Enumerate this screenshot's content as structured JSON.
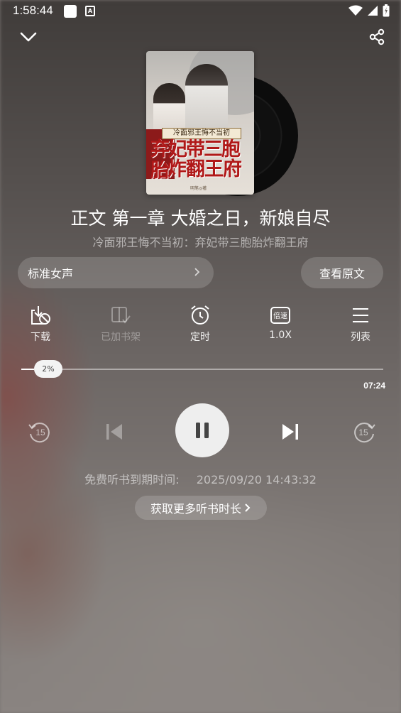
{
  "status_bar": {
    "time": "1:58:44"
  },
  "cover": {
    "ribbon_text": "冷面邪王悔不当初",
    "title_line1": "弃妃带三胞胎",
    "title_line2": "炸翻王府",
    "author": "明笔◎著"
  },
  "player": {
    "chapter_title": "正文 第一章 大婚之日，新娘自尽",
    "book_title": "冷面邪王悔不当初：弃妃带三胞胎炸翻王府",
    "voice_label": "标准女声",
    "view_original_label": "查看原文",
    "toolbar": {
      "download": "下载",
      "bookshelf": "已加书架",
      "timer": "定时",
      "speed_icon_text": "倍速",
      "speed": "1.0X",
      "list": "列表"
    },
    "progress_percent": 2,
    "progress_label": "2%",
    "duration": "07:24",
    "rewind_seconds": "15",
    "forward_seconds": "15",
    "expire_label": "免费听书到期时间:",
    "expire_time": "2025/09/20 14:43:32",
    "more_time_label": "获取更多听书时长"
  },
  "icons": {
    "back": "chevron-down-icon",
    "share": "share-icon",
    "download": "download-icon",
    "bookshelf": "bookshelf-icon",
    "timer": "alarm-clock-icon",
    "speed": "speed-icon",
    "list": "list-icon",
    "rewind": "rewind-15-icon",
    "previous": "skip-previous-icon",
    "pause": "pause-icon",
    "next": "skip-next-icon",
    "forward": "forward-15-icon"
  }
}
